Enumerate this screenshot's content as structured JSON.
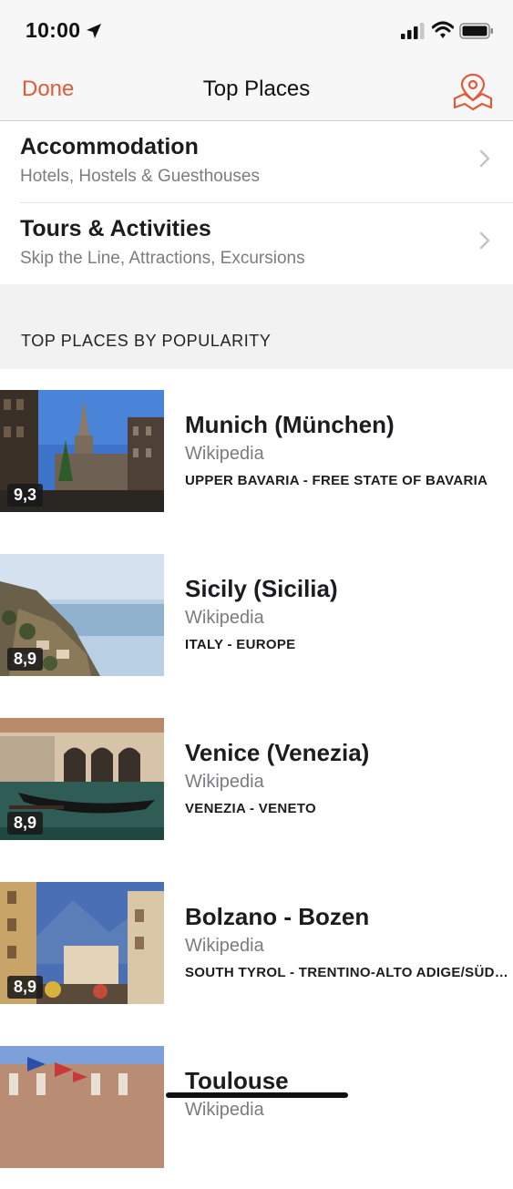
{
  "status": {
    "time": "10:00"
  },
  "nav": {
    "done_label": "Done",
    "title": "Top Places"
  },
  "menu": [
    {
      "title": "Accommodation",
      "subtitle": "Hotels, Hostels & Guesthouses"
    },
    {
      "title": "Tours & Activities",
      "subtitle": "Skip the Line, Attractions, Excursions"
    }
  ],
  "section": {
    "header": "TOP PLACES BY POPULARITY"
  },
  "places": [
    {
      "name": "Munich (München)",
      "source": "Wikipedia",
      "region": "UPPER BAVARIA - FREE STATE OF BAVARIA",
      "rating": "9,3"
    },
    {
      "name": "Sicily (Sicilia)",
      "source": "Wikipedia",
      "region": "ITALY - EUROPE",
      "rating": "8,9"
    },
    {
      "name": "Venice (Venezia)",
      "source": "Wikipedia",
      "region": "VENEZIA - VENETO",
      "rating": "8,9"
    },
    {
      "name": "Bolzano - Bozen",
      "source": "Wikipedia",
      "region": "SOUTH TYROL - TRENTINO-ALTO ADIGE/SÜDT...",
      "rating": "8,9"
    },
    {
      "name": "Toulouse",
      "source": "Wikipedia",
      "region": "",
      "rating": ""
    }
  ],
  "colors": {
    "accent": "#e0593a",
    "header_bg": "#f2f2f2",
    "bar_bg": "#f7f7f7"
  }
}
